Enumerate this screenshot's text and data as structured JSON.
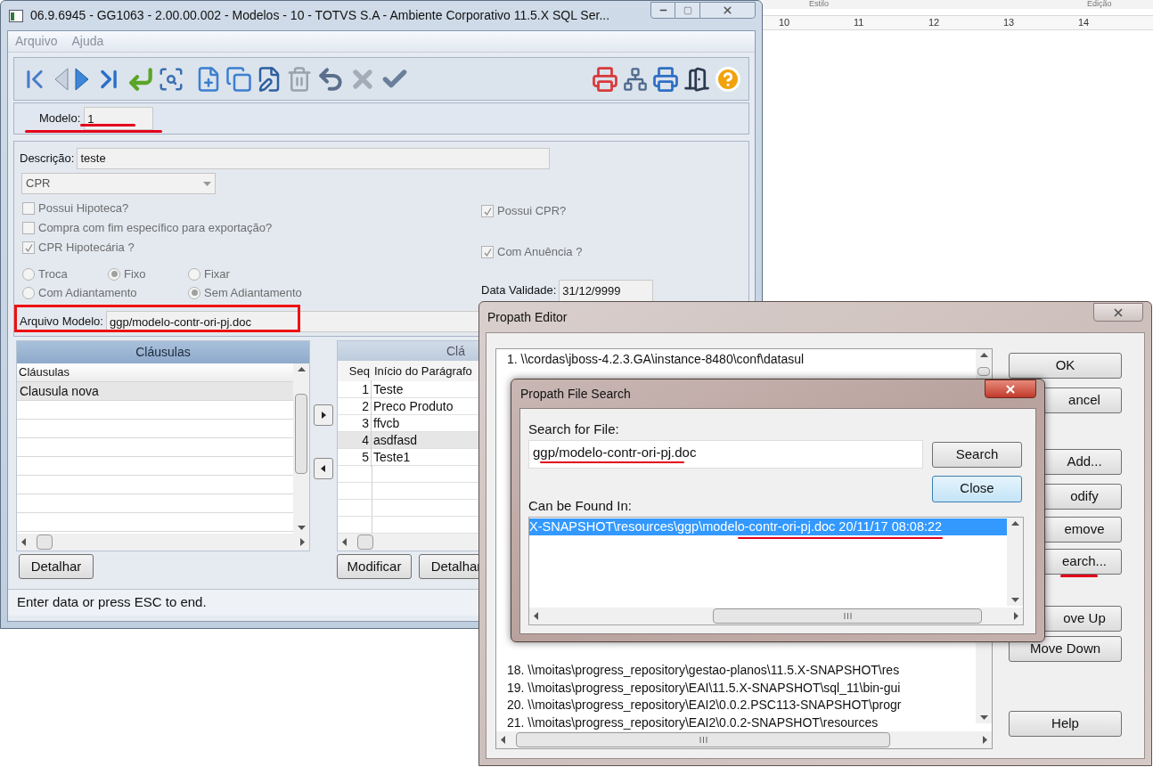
{
  "background_document": {
    "ribbon_groups": [
      "Estilo",
      "Edição"
    ],
    "ruler_numbers": [
      "10",
      "11",
      "12",
      "13",
      "14"
    ]
  },
  "main_window": {
    "title": "06.9.6945 - GG1063 - 2.00.00.002 - Modelos - 10 - TOTVS S.A - Ambiente Corporativo 11.5.X SQL Ser...",
    "menu": [
      "Arquivo",
      "Ajuda"
    ],
    "modelo": {
      "label": "Modelo:",
      "value": "1"
    },
    "descricao": {
      "label": "Descrição:",
      "value": "teste"
    },
    "type_select": {
      "value": "CPR"
    },
    "checkboxes": [
      {
        "label": "Possui Hipoteca?",
        "checked": false
      },
      {
        "label": "Compra com fim específico para exportação?",
        "checked": false
      },
      {
        "label": "CPR Hipotecária ?",
        "checked": true
      }
    ],
    "right_checkboxes": [
      {
        "label": "Possui CPR?",
        "checked": true
      },
      {
        "label": "Com Anuência ?",
        "checked": true
      }
    ],
    "radio_groups": [
      {
        "options": [
          {
            "label": "Troca",
            "selected": false
          },
          {
            "label": "Fixo",
            "selected": true
          },
          {
            "label": "Fixar",
            "selected": false
          }
        ]
      },
      {
        "options": [
          {
            "label": "Com Adiantamento",
            "selected": false
          },
          {
            "label": "Sem Adiantamento",
            "selected": true
          }
        ]
      }
    ],
    "data_validade": {
      "label": "Data Validade:",
      "value": "31/12/9999"
    },
    "arquivo_modelo": {
      "label": "Arquivo Modelo:",
      "value": "ggp/modelo-contr-ori-pj.doc"
    },
    "clausulas_list": {
      "title": "Cláusulas",
      "column": "Cláusulas",
      "rows": [
        {
          "text": "Clausula nova",
          "selected": true
        }
      ],
      "button": "Detalhar"
    },
    "paragraphs_list": {
      "title": "Clá",
      "columns": [
        "Seq",
        "Início do Parágrafo"
      ],
      "rows": [
        {
          "seq": "1",
          "text": "Teste",
          "selected": false
        },
        {
          "seq": "2",
          "text": "Preco Produto",
          "selected": false
        },
        {
          "seq": "3",
          "text": "ffvcb",
          "selected": false
        },
        {
          "seq": "4",
          "text": "asdfasd",
          "selected": true
        },
        {
          "seq": "5",
          "text": "Teste1",
          "selected": false
        }
      ],
      "buttons": [
        "Modificar",
        "Detalhar"
      ]
    },
    "status": "Enter data or press ESC to end."
  },
  "propath_editor": {
    "title": "Propath Editor",
    "entries": [
      "1. \\\\cordas\\jboss-4.2.3.GA\\instance-8480\\conf\\datasul",
      "18. \\\\moitas\\progress_repository\\gestao-planos\\11.5.X-SNAPSHOT\\res",
      "19. \\\\moitas\\progress_repository\\EAI\\11.5.X-SNAPSHOT\\sql_11\\bin-gui",
      "20. \\\\moitas\\progress_repository\\EAI2\\0.0.2.PSC113-SNAPSHOT\\progr",
      "21. \\\\moitas\\progress_repository\\EAI2\\0.0.2-SNAPSHOT\\resources"
    ],
    "buttons": [
      "OK",
      "ancel",
      "Add...",
      "odify",
      "emove",
      "earch...",
      "ove Up",
      "Move Down",
      "Help"
    ]
  },
  "file_search": {
    "title": "Propath File Search",
    "search_label": "Search for File:",
    "search_value": "ggp/modelo-contr-ori-pj.doc",
    "search_button": "Search",
    "close_button": "Close",
    "found_label": "Can be Found In:",
    "results": [
      {
        "text": "X-SNAPSHOT\\resources\\ggp\\modelo-contr-ori-pj.doc 20/11/17 08:08:22",
        "selected": true
      }
    ]
  }
}
